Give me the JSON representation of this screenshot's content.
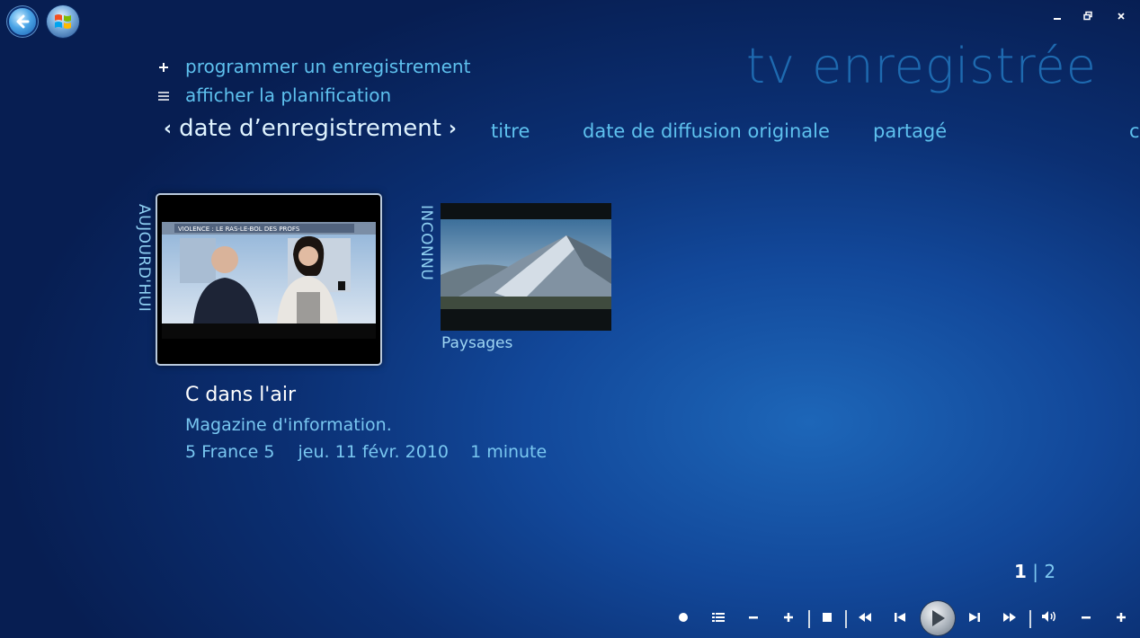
{
  "window": {
    "title": "tv enregistrée"
  },
  "menu": {
    "items": [
      {
        "icon": "plus-icon",
        "label": "programmer un enregistrement"
      },
      {
        "icon": "list-icon",
        "label": "afficher la planification"
      }
    ]
  },
  "tabs": {
    "active": "date d’enregistrement",
    "items": [
      "titre",
      "date de diffusion originale",
      "partagé"
    ]
  },
  "groups": [
    {
      "label": "AUJOURD'HUI"
    },
    {
      "label": "INCONNU"
    }
  ],
  "recordings": [
    {
      "title": "C dans l'air",
      "description": "Magazine d'information.",
      "channel": "5 France 5",
      "date": "jeu. 11 févr. 2010",
      "duration": "1 minute",
      "thumb_caption": "VIOLENCE : LE RAS-LE-BOL DES PROFS"
    },
    {
      "title": "Paysages"
    }
  ],
  "pager": {
    "current": "1",
    "separator": "|",
    "total": "2"
  }
}
